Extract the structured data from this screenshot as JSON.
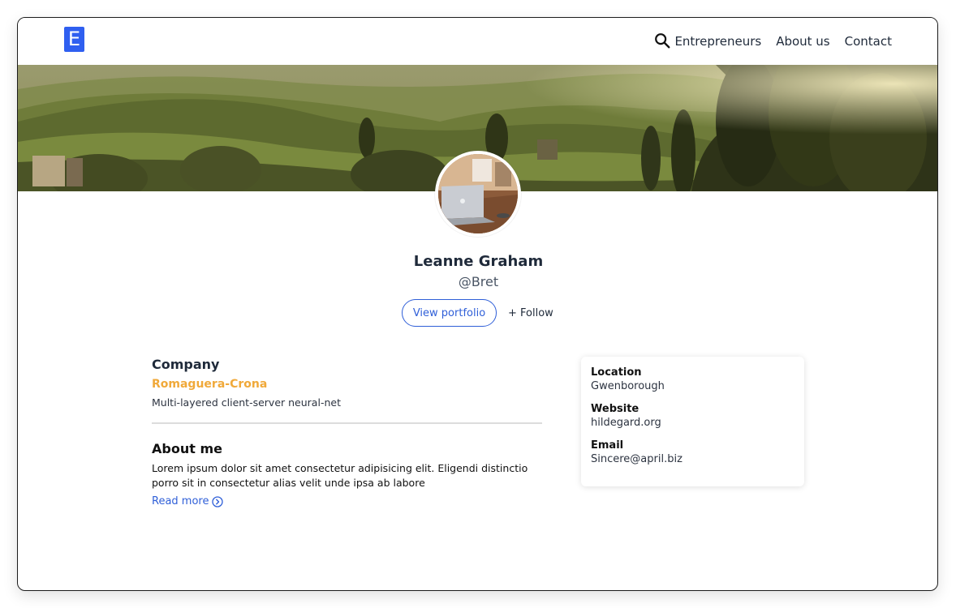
{
  "header": {
    "logo_letter": "E",
    "nav": [
      "Entrepreneurs",
      "About us",
      "Contact"
    ]
  },
  "profile": {
    "name": "Leanne Graham",
    "handle": "@Bret",
    "view_portfolio_label": "View portfolio",
    "follow_label": "+ Follow"
  },
  "company": {
    "title": "Company",
    "name": "Romaguera-Crona",
    "catch_phrase": "Multi-layered client-server neural-net"
  },
  "about": {
    "title": "About me",
    "text": "Lorem ipsum dolor sit amet consectetur adipisicing elit. Eligendi distinctio porro sit in consectetur alias velit unde ipsa ab labore",
    "read_more_label": "Read more"
  },
  "info": {
    "location_label": "Location",
    "location": "Gwenborough",
    "website_label": "Website",
    "website": "hildegard.org",
    "email_label": "Email",
    "email": "Sincere@april.biz"
  },
  "colors": {
    "accent": "#2f5fd8",
    "logo": "#2f5ff0",
    "company_name": "#f0a93a",
    "text": "#1f2a3a"
  },
  "icons": {
    "search": "search-icon",
    "read_more": "chevron-right-circle-icon"
  }
}
